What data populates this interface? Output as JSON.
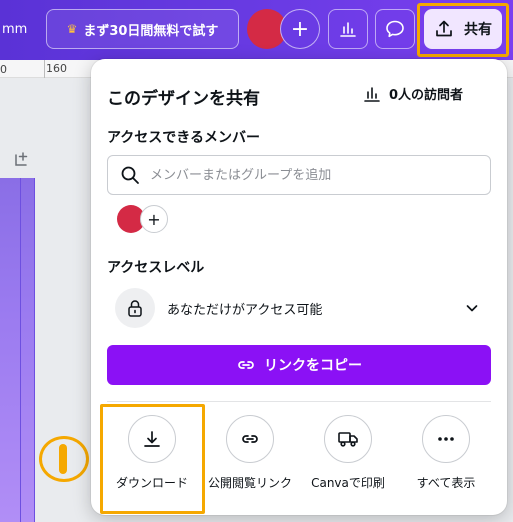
{
  "topbar": {
    "unit_label": "mm",
    "trial_button": "まず30日間無料で試す",
    "share_button": "共有",
    "add_button": "+"
  },
  "ruler": {
    "mark_0": "0",
    "mark_160": "160"
  },
  "share_panel": {
    "title": "このデザインを共有",
    "visitors": "0人の訪問者",
    "members_label": "アクセスできるメンバー",
    "search_placeholder": "メンバーまたはグループを追加",
    "add_member": "+",
    "access_level_label": "アクセスレベル",
    "access_value": "あなただけがアクセス可能",
    "copy_link_button": "リンクをコピー",
    "actions": [
      {
        "label": "ダウンロード",
        "icon": "download-icon"
      },
      {
        "label": "公開閲覧リンク",
        "icon": "link-icon"
      },
      {
        "label": "Canvaで印刷",
        "icon": "truck-icon"
      },
      {
        "label": "すべて表示",
        "icon": "more-icon"
      }
    ]
  },
  "colors": {
    "topbar_gradient_start": "#5a32d6",
    "topbar_gradient_end": "#7b3ff0",
    "accent_purple": "#8b11f5",
    "avatar_red": "#d42a45",
    "highlight_orange": "#f5a800",
    "share_button_bg": "#f1e6ff"
  }
}
